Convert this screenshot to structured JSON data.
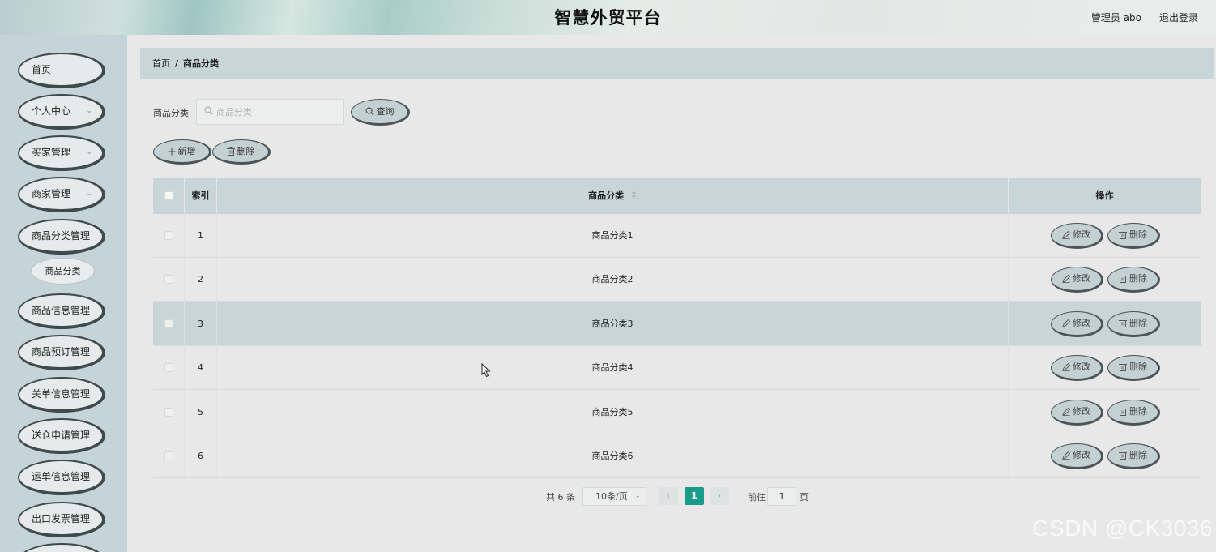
{
  "header": {
    "title": "智慧外贸平台",
    "user": "管理员 abo",
    "logout": "退出登录"
  },
  "sidebar": {
    "items": [
      {
        "label": "首页",
        "has_chevron": false
      },
      {
        "label": "个人中心",
        "has_chevron": true
      },
      {
        "label": "买家管理",
        "has_chevron": true
      },
      {
        "label": "商家管理",
        "has_chevron": true
      },
      {
        "label": "商品分类管理",
        "has_chevron": false
      },
      {
        "label": "商品信息管理",
        "has_chevron": false
      },
      {
        "label": "商品预订管理",
        "has_chevron": false
      },
      {
        "label": "关单信息管理",
        "has_chevron": false
      },
      {
        "label": "送仓申请管理",
        "has_chevron": false
      },
      {
        "label": "运单信息管理",
        "has_chevron": false
      },
      {
        "label": "出口发票管理",
        "has_chevron": false
      }
    ],
    "submenu": {
      "label": "商品分类"
    },
    "chevron": "⌄"
  },
  "breadcrumb": {
    "home": "首页",
    "separator": "/",
    "current": "商品分类"
  },
  "search": {
    "label": "商品分类",
    "placeholder": "商品分类",
    "value": "",
    "button": "查询"
  },
  "actions": {
    "add": "新增",
    "delete": "删除"
  },
  "table": {
    "headers": {
      "index": "索引",
      "category": "商品分类",
      "operations": "操作"
    },
    "rows": [
      {
        "index": "1",
        "category": "商品分类1"
      },
      {
        "index": "2",
        "category": "商品分类2"
      },
      {
        "index": "3",
        "category": "商品分类3"
      },
      {
        "index": "4",
        "category": "商品分类4"
      },
      {
        "index": "5",
        "category": "商品分类5"
      },
      {
        "index": "6",
        "category": "商品分类6"
      }
    ],
    "highlighted_row": 3,
    "edit_label": "修改",
    "delete_label": "删除"
  },
  "pagination": {
    "total": "共 6 条",
    "page_size": "10条/页",
    "prev": "‹",
    "current_page": "1",
    "next": "›",
    "goto": "前往",
    "goto_value": "1",
    "suffix": "页"
  },
  "watermark": "CSDN @CK3036",
  "colors": {
    "accent": "#1a9a8a",
    "header_bg": "#c8d5d9",
    "sidebar_bg": "#c5d4d8",
    "button_bg": "#c4d1d4"
  }
}
